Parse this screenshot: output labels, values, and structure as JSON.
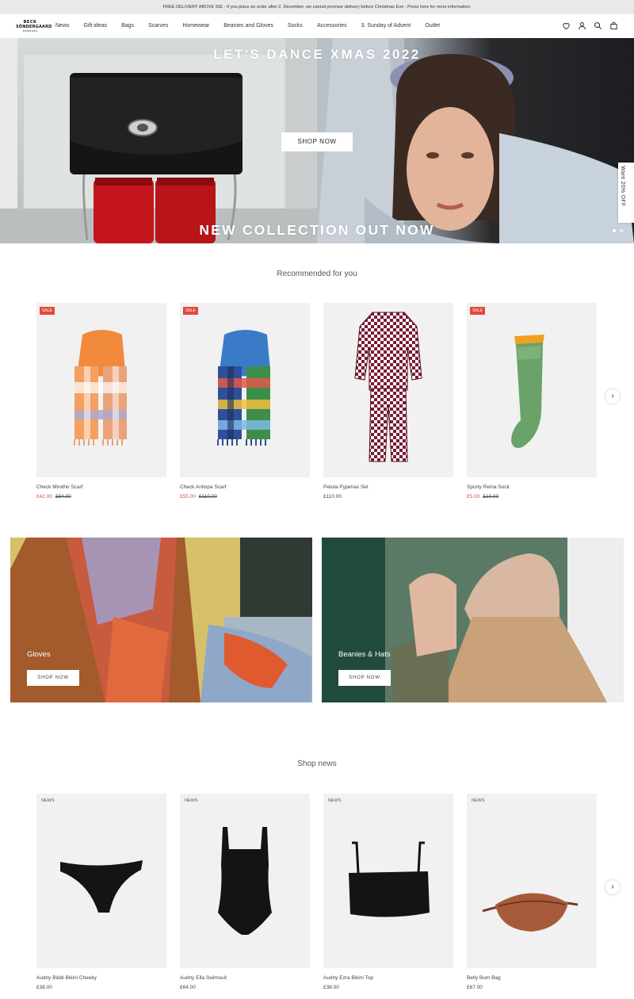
{
  "announcement": "FREE DELIVERY ABOVE 59£ - If you place an order after 2. December, we cannot promise delivery before Christmas Eve - Press here for more information.",
  "logo": {
    "line1": "BECK",
    "line2": "SÖNDERGAARD",
    "line3": "DENMARK"
  },
  "nav": [
    "News",
    "Gift ideas",
    "Bags",
    "Scarves",
    "Homewear",
    "Beanies and Gloves",
    "Socks",
    "Accessories",
    "3. Sunday of Advent",
    "Outlet"
  ],
  "icons": [
    "heart-icon",
    "account-icon",
    "search-icon",
    "bag-icon"
  ],
  "hero": {
    "title_top": "LET'S DANCE XMAS 2022",
    "title_bottom": "NEW COLLECTION OUT NOW",
    "button": "SHOP NOW",
    "side_tab": "Want 20% OFF"
  },
  "recommended": {
    "title": "Recommended for you",
    "products": [
      {
        "badge": "SALE",
        "name": "Check Mindho Scarf",
        "price": "£42.00",
        "old_price": "£84.00"
      },
      {
        "badge": "SALE",
        "name": "Check Anilopa Scarf",
        "price": "£55.00",
        "old_price": "£110.00"
      },
      {
        "badge": "",
        "name": "Petula Pyjamas Set",
        "price": "£110.00",
        "old_price": ""
      },
      {
        "badge": "SALE",
        "name": "Sporty Reina Sock",
        "price": "£5.00",
        "old_price": "£10.00"
      }
    ]
  },
  "promos": [
    {
      "label": "Gloves",
      "button": "SHOP NOW"
    },
    {
      "label": "Beanies & Hats",
      "button": "SHOP NOW"
    }
  ],
  "news": {
    "title": "Shop news",
    "products": [
      {
        "badge": "NEWS",
        "name": "Audny Biddi Bikini Cheeky",
        "price": "£38.00"
      },
      {
        "badge": "NEWS",
        "name": "Audny Ella Swimsuit",
        "price": "£64.00"
      },
      {
        "badge": "NEWS",
        "name": "Audny Ezra Bikini Top",
        "price": "£38.00"
      },
      {
        "badge": "NEWS",
        "name": "Belly Bum Bag",
        "price": "£67.00"
      }
    ]
  },
  "colors": {
    "sale": "#e4493c",
    "topbar": "#e9e9e9"
  }
}
